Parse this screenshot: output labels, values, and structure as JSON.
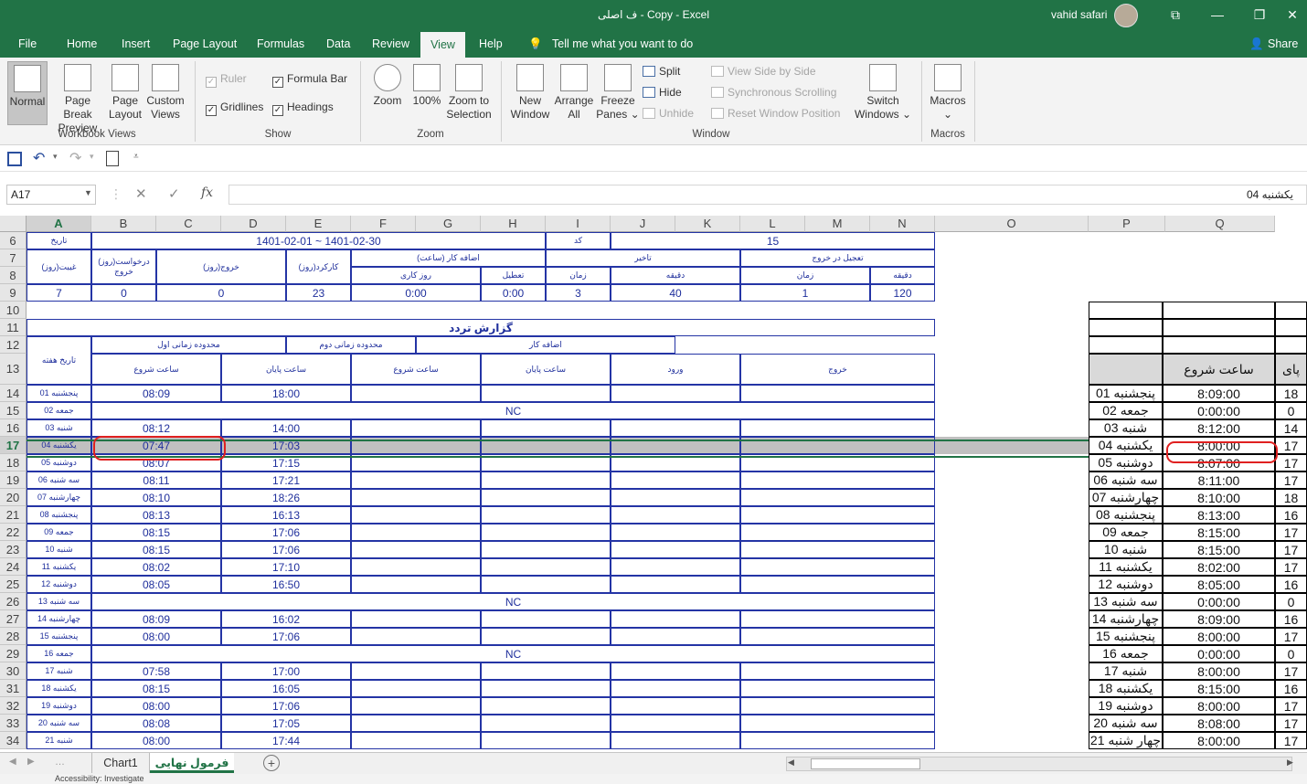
{
  "window": {
    "title": "ف اصلی - Copy  -  Excel",
    "user": "vahid safari",
    "controls": {
      "ribbon_display": "⧉",
      "minimize": "—",
      "restore": "❐",
      "close": "✕"
    }
  },
  "ribbon_tabs": [
    "File",
    "Home",
    "Insert",
    "Page Layout",
    "Formulas",
    "Data",
    "Review",
    "View",
    "Help"
  ],
  "tell_me": "Tell me what you want to do",
  "share": "Share",
  "ribbon": {
    "workbook_views": {
      "label": "Workbook Views",
      "normal": "Normal",
      "page_break_1": "Page Break",
      "page_break_2": "Preview",
      "page_layout_1": "Page",
      "page_layout_2": "Layout",
      "custom_1": "Custom",
      "custom_2": "Views"
    },
    "show": {
      "label": "Show",
      "ruler": "Ruler",
      "formula_bar": "Formula Bar",
      "gridlines": "Gridlines",
      "headings": "Headings"
    },
    "zoom": {
      "label": "Zoom",
      "zoom": "Zoom",
      "hundred": "100%",
      "zoom_sel_1": "Zoom to",
      "zoom_sel_2": "Selection"
    },
    "window": {
      "label": "Window",
      "new_1": "New",
      "new_2": "Window",
      "arrange_1": "Arrange",
      "arrange_2": "All",
      "freeze_1": "Freeze",
      "freeze_2": "Panes ⌄",
      "split": "Split",
      "hide": "Hide",
      "unhide": "Unhide",
      "side": "View Side by Side",
      "sync": "Synchronous Scrolling",
      "reset": "Reset Window Position",
      "switch_1": "Switch",
      "switch_2": "Windows ⌄"
    },
    "macros": {
      "label": "Macros",
      "macros": "Macros",
      "caret": "⌄"
    }
  },
  "formula_bar": {
    "name_box": "A17",
    "content": "یکشنبه 04"
  },
  "columns_left": [
    "A",
    "B",
    "C",
    "D",
    "E",
    "F",
    "G",
    "H",
    "I",
    "J",
    "K",
    "L",
    "M",
    "N",
    "O"
  ],
  "columns_right": [
    "P",
    "Q"
  ],
  "rows": [
    "6",
    "7",
    "8",
    "9",
    "10",
    "11",
    "12",
    "13",
    "14",
    "15",
    "16",
    "17",
    "18",
    "19",
    "20",
    "21",
    "22",
    "23",
    "24",
    "25",
    "26",
    "27",
    "28",
    "29",
    "30",
    "31",
    "32",
    "33",
    "34"
  ],
  "header_block": {
    "date_label": "تاریخ",
    "date_range": "1401-02-01 ~ 1401-02-30",
    "code_label": "کد",
    "code_value": "15",
    "absence": "(روز)غیبت",
    "exit_request_1": "(روز)درخواست",
    "exit_request_2": "خروج",
    "exit": "(روز)خروج",
    "work_days": "(روز)کارکرد",
    "overtime_hours": "اضافه کار (ساعت)",
    "delay": "تاخیر",
    "early_exit": "تعجیل در خروج",
    "workday_sub": "روز کاری",
    "holiday_sub": "تعطیل",
    "count_sub": "زمان",
    "minute_sub": "دقیقه",
    "values": {
      "absence": "7",
      "exit_request": "0",
      "exit": "0",
      "work_days": "23",
      "ot_workday": "0:00",
      "ot_holiday": "0:00",
      "delay_count": "3",
      "delay_minutes": "40",
      "early_count": "1",
      "early_minutes": "120"
    }
  },
  "report": {
    "title": "گزارش تردد",
    "day_date": "تاریخ هفته",
    "range1": "محدوده زمانی اول",
    "range2": "محدوده زمانی دوم",
    "overtime": "اضافه کار",
    "start": "ساعت شروع",
    "end": "ساعت پایان",
    "entry": "ورود",
    "leave": "خروج"
  },
  "days": [
    {
      "day": "پنجشنبه 01",
      "start": "08:09",
      "end": "18:00"
    },
    {
      "day": "جمعه 02",
      "nc": "NC"
    },
    {
      "day": "شنبه 03",
      "start": "08:12",
      "end": "14:00"
    },
    {
      "day": "یکشنبه 04",
      "start": "07:47",
      "end": "17:03"
    },
    {
      "day": "دوشنبه 05",
      "start": "08:07",
      "end": "17:15"
    },
    {
      "day": "سه شنبه 06",
      "start": "08:11",
      "end": "17:21"
    },
    {
      "day": "چهارشنبه 07",
      "start": "08:10",
      "end": "18:26"
    },
    {
      "day": "پنجشنبه 08",
      "start": "08:13",
      "end": "16:13"
    },
    {
      "day": "جمعه 09",
      "start": "08:15",
      "end": "17:06"
    },
    {
      "day": "شنبه 10",
      "start": "08:15",
      "end": "17:06"
    },
    {
      "day": "یکشنبه 11",
      "start": "08:02",
      "end": "17:10"
    },
    {
      "day": "دوشنبه 12",
      "start": "08:05",
      "end": "16:50"
    },
    {
      "day": "سه شنبه 13",
      "nc": "NC"
    },
    {
      "day": "چهارشنبه 14",
      "start": "08:09",
      "end": "16:02"
    },
    {
      "day": "پنجشنبه 15",
      "start": "08:00",
      "end": "17:06"
    },
    {
      "day": "جمعه 16",
      "nc": "NC"
    },
    {
      "day": "شنبه 17",
      "start": "07:58",
      "end": "17:00"
    },
    {
      "day": "یکشنبه 18",
      "start": "08:15",
      "end": "16:05"
    },
    {
      "day": "دوشنبه 19",
      "start": "08:00",
      "end": "17:06"
    },
    {
      "day": "سه شنبه 20",
      "start": "08:08",
      "end": "17:05"
    },
    {
      "day": "شنبه 21",
      "start": "08:00",
      "end": "17:44"
    }
  ],
  "right_table": {
    "header": "ساعت شروع",
    "header_edge": "پای",
    "rows": [
      {
        "day": "پنجشنبه 01",
        "start": "8:09:00",
        "edge": "18"
      },
      {
        "day": "جمعه 02",
        "start": "0:00:00",
        "edge": "0"
      },
      {
        "day": "شنبه 03",
        "start": "8:12:00",
        "edge": "14"
      },
      {
        "day": "یکشنبه 04",
        "start": "8:00:00",
        "edge": "17"
      },
      {
        "day": "دوشنبه 05",
        "start": "8:07:00",
        "edge": "17"
      },
      {
        "day": "سه شنبه 06",
        "start": "8:11:00",
        "edge": "17"
      },
      {
        "day": "چهارشنبه 07",
        "start": "8:10:00",
        "edge": "18"
      },
      {
        "day": "پنجشنبه 08",
        "start": "8:13:00",
        "edge": "16"
      },
      {
        "day": "جمعه 09",
        "start": "8:15:00",
        "edge": "17"
      },
      {
        "day": "شنبه 10",
        "start": "8:15:00",
        "edge": "17"
      },
      {
        "day": "یکشنبه 11",
        "start": "8:02:00",
        "edge": "17"
      },
      {
        "day": "دوشنبه 12",
        "start": "8:05:00",
        "edge": "16"
      },
      {
        "day": "سه شنبه 13",
        "start": "0:00:00",
        "edge": "0"
      },
      {
        "day": "چهارشنبه 14",
        "start": "8:09:00",
        "edge": "16"
      },
      {
        "day": "پنجشنبه 15",
        "start": "8:00:00",
        "edge": "17"
      },
      {
        "day": "جمعه 16",
        "start": "0:00:00",
        "edge": "0"
      },
      {
        "day": "شنبه 17",
        "start": "8:00:00",
        "edge": "17"
      },
      {
        "day": "یکشنبه 18",
        "start": "8:15:00",
        "edge": "16"
      },
      {
        "day": "دوشنبه 19",
        "start": "8:00:00",
        "edge": "17"
      },
      {
        "day": "سه شنبه 20",
        "start": "8:08:00",
        "edge": "17"
      },
      {
        "day": "چهار شنبه 21",
        "start": "8:00:00",
        "edge": "17"
      }
    ]
  },
  "sheet_tabs": {
    "chart": "Chart1",
    "final": "فرمول نهایی",
    "add": "+"
  },
  "status": {
    "accessibility": "Accessibility: Investigate"
  },
  "colors": {
    "excel_green": "#217346",
    "cell_border": "#2434a5",
    "highlight": "#e02020"
  }
}
